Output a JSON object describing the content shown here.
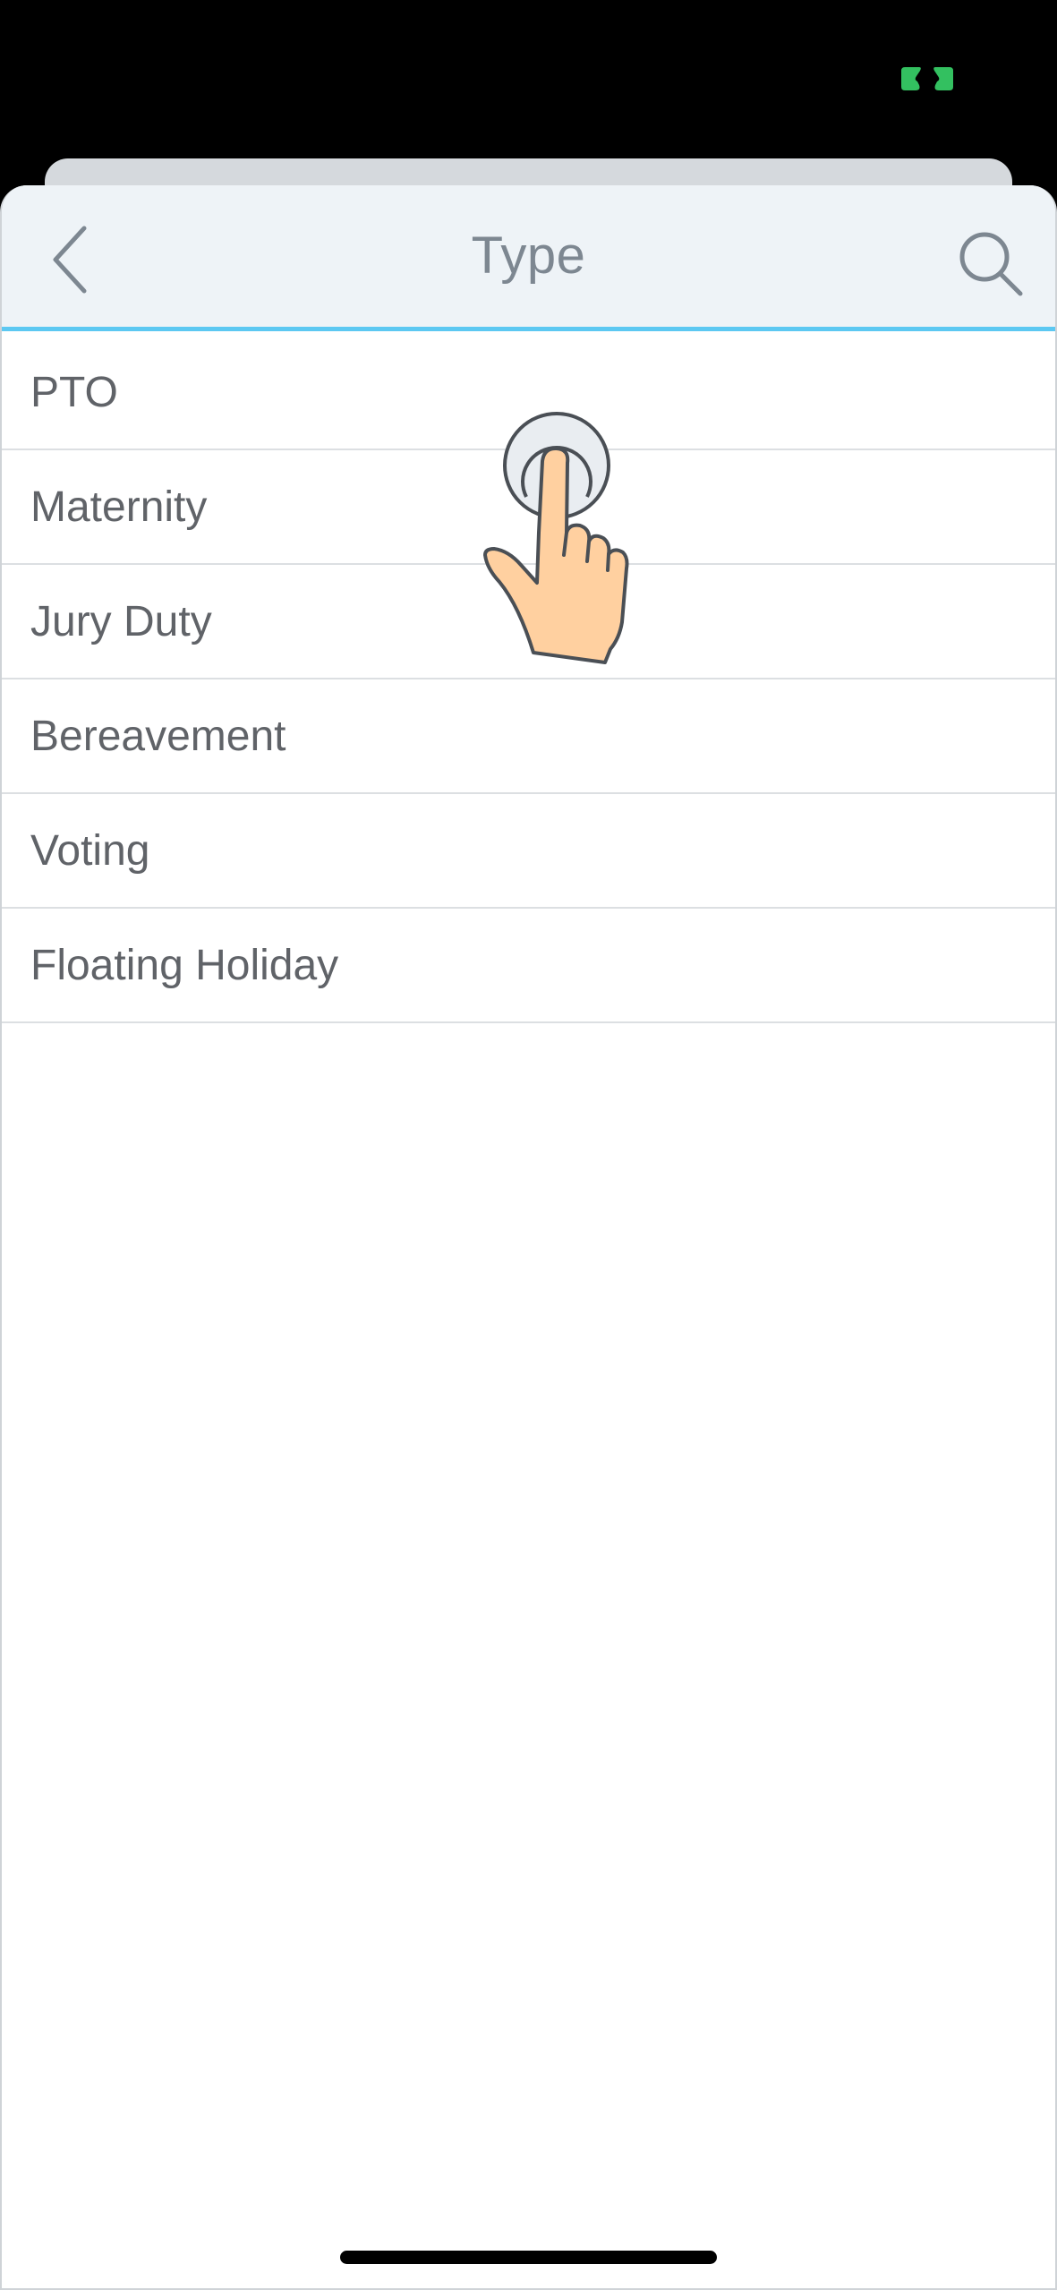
{
  "nav": {
    "title": "Type"
  },
  "type_options": [
    {
      "label": "PTO"
    },
    {
      "label": "Maternity"
    },
    {
      "label": "Jury Duty"
    },
    {
      "label": "Bereavement"
    },
    {
      "label": "Voting"
    },
    {
      "label": "Floating Holiday"
    }
  ],
  "icons": {
    "back": "chevron-left-icon",
    "search": "search-icon",
    "tap": "tap-gesture-icon",
    "status": "link-icon"
  },
  "colors": {
    "nav_background": "#eef3f7",
    "nav_underline": "#5cc8f2",
    "title_text": "#7d8791",
    "item_text": "#606368",
    "status_indicator": "#33c060"
  }
}
